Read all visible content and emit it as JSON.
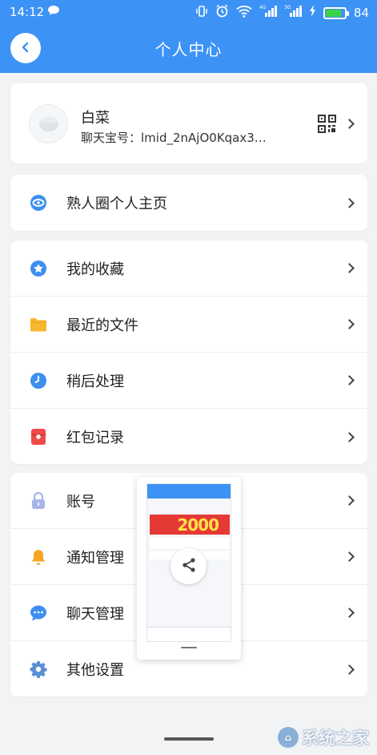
{
  "status_bar": {
    "time": "14:12",
    "battery_percent": "84",
    "battery_level": 0.84,
    "icons": [
      "chat-bubble-icon",
      "vibrate-icon",
      "alarm-icon",
      "wifi-icon",
      "signal-4g-icon",
      "signal-3g-icon",
      "charging-icon"
    ]
  },
  "header": {
    "title": "个人中心",
    "back_icon": "chevron-left-icon"
  },
  "profile": {
    "name": "白菜",
    "id_label": "聊天宝号：",
    "id_value": "lmid_2nAjO0Kqax3…",
    "qr_icon": "qr-code-icon"
  },
  "sections": {
    "moments": {
      "label": "熟人圈个人主页",
      "icon": "moments-icon"
    },
    "group2": [
      {
        "label": "我的收藏",
        "icon": "star-icon",
        "color": "#3d8ef0"
      },
      {
        "label": "最近的文件",
        "icon": "folder-icon",
        "color": "#f5b82e"
      },
      {
        "label": "稍后处理",
        "icon": "clock-icon",
        "color": "#3d8ef0"
      },
      {
        "label": "红包记录",
        "icon": "red-envelope-icon",
        "color": "#ef4a4a"
      }
    ],
    "group3": [
      {
        "label": "账号",
        "icon": "lock-icon",
        "color": "#a8b4ec"
      },
      {
        "label": "通知管理",
        "icon": "bell-icon",
        "color": "#f5a623"
      },
      {
        "label": "聊天管理",
        "icon": "chat-icon",
        "color": "#3d8ef0"
      },
      {
        "label": "其他设置",
        "icon": "gear-icon",
        "color": "#5a8fd6"
      }
    ]
  },
  "preview": {
    "banner_number": "2000",
    "share_icon": "share-icon"
  },
  "watermark": "系统之家",
  "colors": {
    "accent": "#3d92f5",
    "background": "#f2f3f5"
  }
}
